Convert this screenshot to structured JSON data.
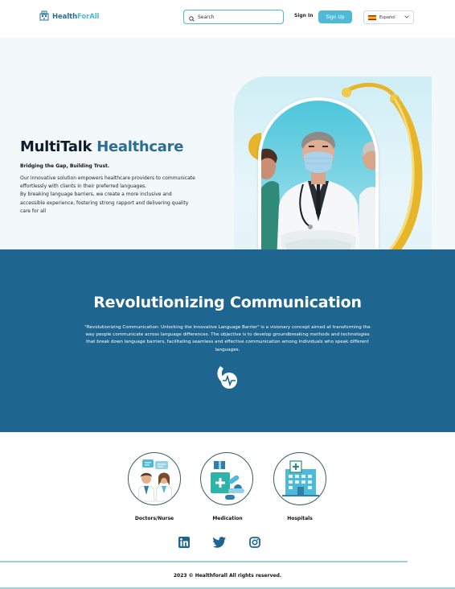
{
  "header": {
    "brand_part1": "Health",
    "brand_part2": "ForAll",
    "search_placeholder": "Search",
    "sign_in": "Sign In",
    "sign_up": "Sign Up",
    "language": "Español"
  },
  "hero": {
    "title_part1": "MultiTalk",
    "title_part2": "Healthcare",
    "subtitle": "Bridging the Gap, Building Trust.",
    "paragraph1": "Our innovative solution empowers healthcare providers to communicate effortlessly with clients in their preferred languages.",
    "paragraph2": "By breaking language barriers, we create a more inclusive and accessible experience, fostering strong rapport and delivering quality care for all"
  },
  "mission": {
    "title": "Revolutionizing Communication",
    "body": "\"Revolutionizing Communication: Unlocking the Innovative Language Barrier\" is a visionary concept aimed at transforming the way people communicate across language differences. The objective is to develop groundbreaking methods and technologies that break down language barriers, facilitating seamless and effective communication among individuals who speak different languages."
  },
  "categories": [
    {
      "label": "Doctors/Nurse",
      "icon": "doctors-icon"
    },
    {
      "label": "Medication",
      "icon": "medication-icon"
    },
    {
      "label": "Hospitals",
      "icon": "hospital-icon"
    }
  ],
  "social": [
    "linkedin-icon",
    "twitter-icon",
    "instagram-icon"
  ],
  "footer": {
    "copyright": "2023 © Healthforall All rights reserved."
  },
  "colors": {
    "brand_dark": "#2a6f93",
    "brand_light": "#4fb9d8",
    "section_blue": "#1e6690"
  }
}
